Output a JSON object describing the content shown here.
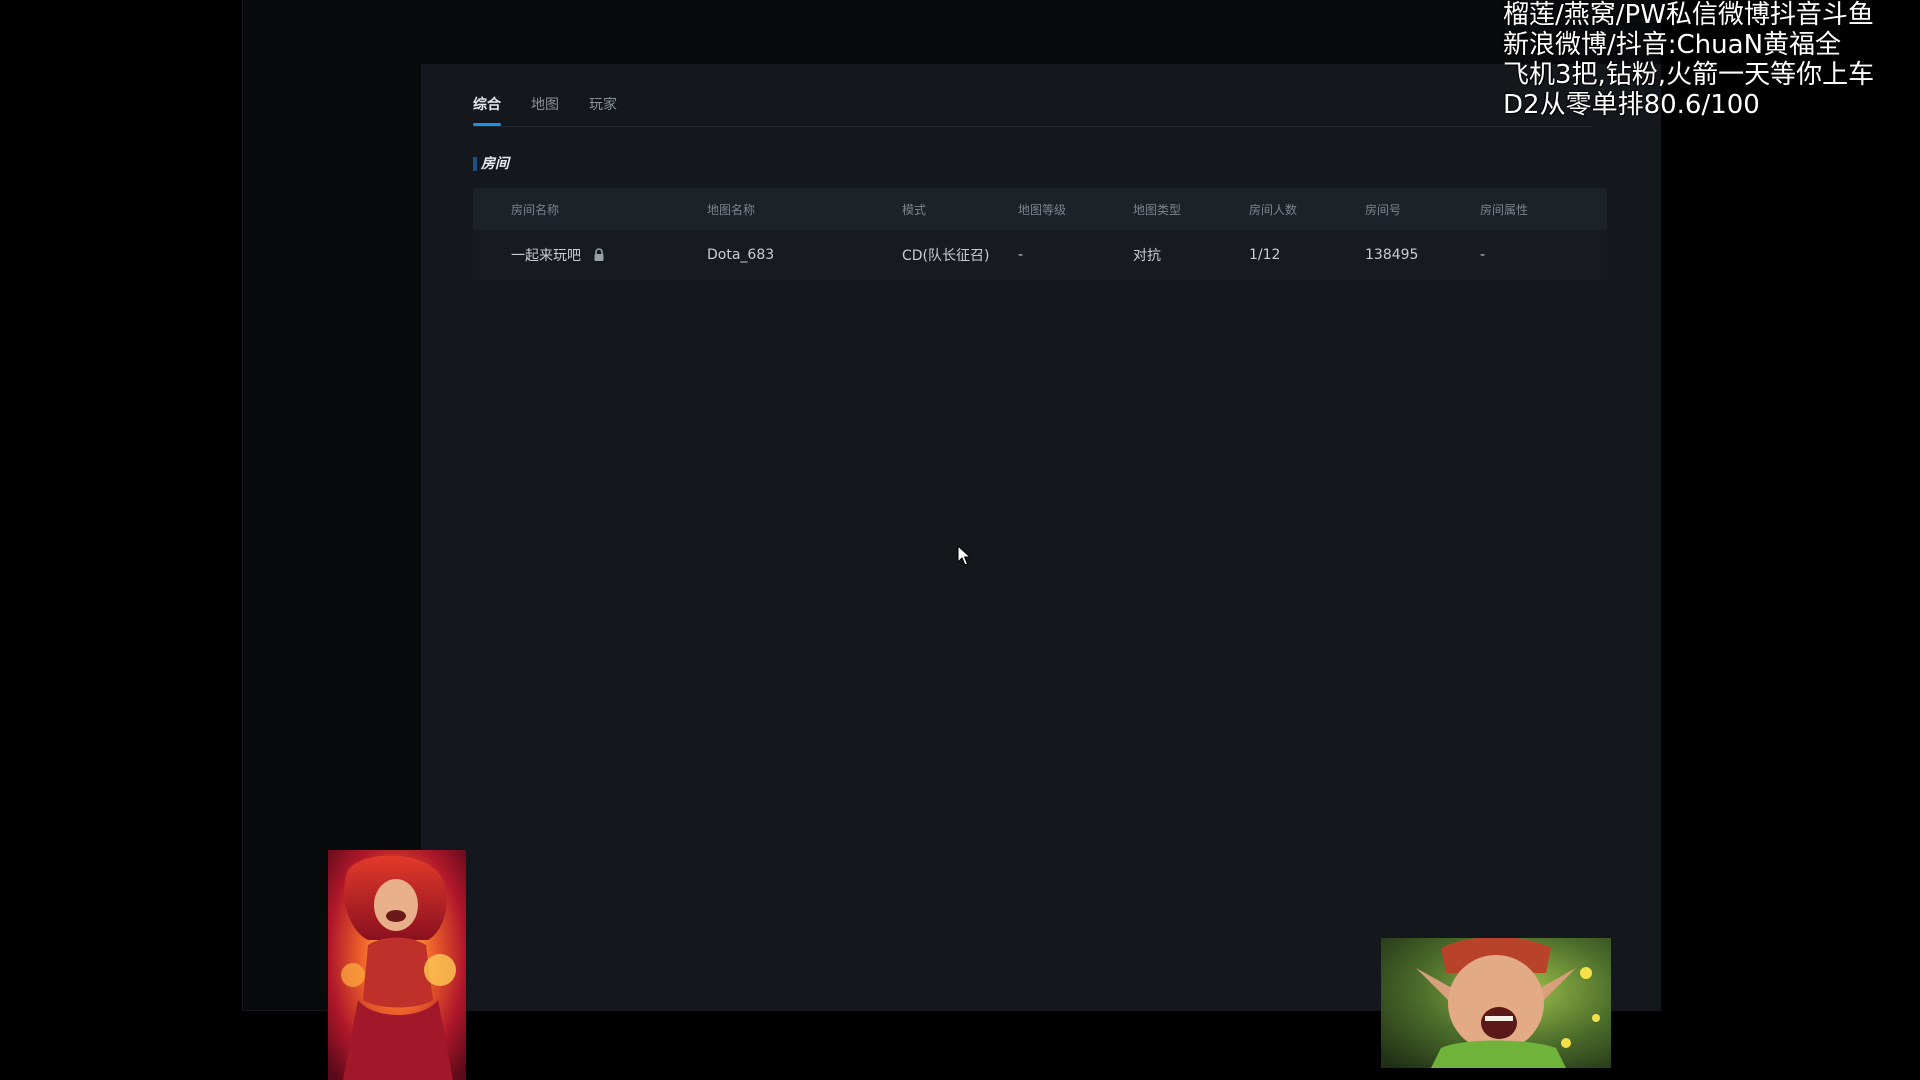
{
  "tabs": [
    {
      "label": "综合",
      "active": true
    },
    {
      "label": "地图",
      "active": false
    },
    {
      "label": "玩家",
      "active": false
    }
  ],
  "section": {
    "title": "房间"
  },
  "table": {
    "columns": [
      "房间名称",
      "地图名称",
      "模式",
      "地图等级",
      "地图类型",
      "房间人数",
      "房间号",
      "房间属性"
    ],
    "rows": [
      {
        "room_name": "一起来玩吧",
        "locked": true,
        "map_name": "Dota_683",
        "mode": "CD(队长征召)",
        "map_level": "-",
        "map_type": "对抗",
        "players": "1/12",
        "room_id": "138495",
        "room_attr": "-"
      }
    ]
  },
  "stream_overlay": {
    "lines": [
      "榴莲/燕窝/PW私信微博抖音斗鱼",
      "新浪微博/抖音:ChuaN黄福全",
      "飞机3把,钻粉,火箭一天等你上车",
      "D2从零单排80.6/100"
    ]
  },
  "colors": {
    "background": "#000000",
    "panel": "#14171c",
    "accent": "#1e90e8",
    "text_primary": "#e6e8eb",
    "text_muted": "#7d838c"
  },
  "icons": {
    "lock": "lock-icon",
    "cursor": "mouse-cursor-icon"
  }
}
